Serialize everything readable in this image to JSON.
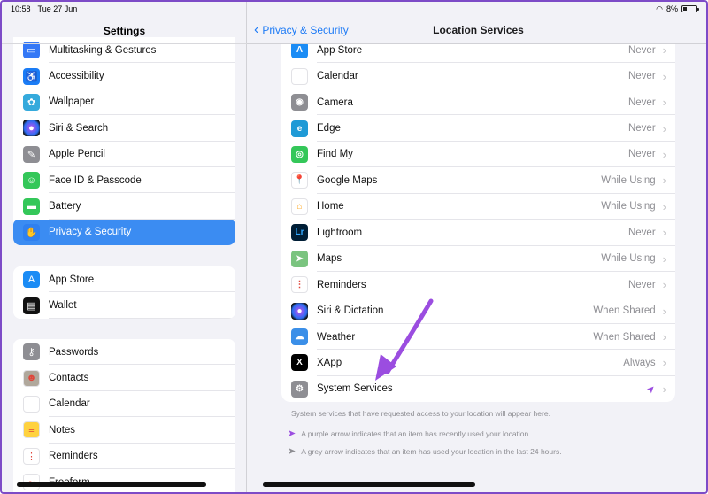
{
  "status": {
    "time": "10:58",
    "date": "Tue 27 Jun",
    "battery": "8%"
  },
  "sidebar": {
    "title": "Settings",
    "group1": [
      {
        "label": "Multitasking & Gestures",
        "icon": "multitasking-icon",
        "color": "#3478f6"
      },
      {
        "label": "Accessibility",
        "icon": "accessibility-icon",
        "color": "#1b7cf5"
      },
      {
        "label": "Wallpaper",
        "icon": "wallpaper-icon",
        "color": "#35aadc"
      },
      {
        "label": "Siri & Search",
        "icon": "siri-icon",
        "color": "#222222"
      },
      {
        "label": "Apple Pencil",
        "icon": "pencil-icon",
        "color": "#8e8e93"
      },
      {
        "label": "Face ID & Passcode",
        "icon": "faceid-icon",
        "color": "#34c759"
      },
      {
        "label": "Battery",
        "icon": "battery-icon",
        "color": "#34c759"
      },
      {
        "label": "Privacy & Security",
        "icon": "hand-icon",
        "color": "#2f80f0",
        "active": true
      }
    ],
    "group2": [
      {
        "label": "App Store",
        "icon": "appstore-icon",
        "color": "#1b8cf5"
      },
      {
        "label": "Wallet",
        "icon": "wallet-icon",
        "color": "#111111"
      }
    ],
    "group3": [
      {
        "label": "Passwords",
        "icon": "key-icon",
        "color": "#8e8e93"
      },
      {
        "label": "Contacts",
        "icon": "contacts-icon",
        "color": "#b0a89c"
      },
      {
        "label": "Calendar",
        "icon": "calendar-icon",
        "color": "#ffffff"
      },
      {
        "label": "Notes",
        "icon": "notes-icon",
        "color": "#ffd23f"
      },
      {
        "label": "Reminders",
        "icon": "reminders-icon",
        "color": "#ffffff"
      },
      {
        "label": "Freeform",
        "icon": "freeform-icon",
        "color": "#ffffff"
      }
    ]
  },
  "nav": {
    "back_label": "Privacy & Security",
    "title": "Location Services"
  },
  "apps": [
    {
      "label": "App Store",
      "value": "Never",
      "icon": "appstore-icon",
      "color": "#1b8cf5"
    },
    {
      "label": "Calendar",
      "value": "Never",
      "icon": "calendar-icon",
      "color": "#ffffff"
    },
    {
      "label": "Camera",
      "value": "Never",
      "icon": "camera-icon",
      "color": "#8e8e93"
    },
    {
      "label": "Edge",
      "value": "Never",
      "icon": "edge-icon",
      "color": "#1f9ad6"
    },
    {
      "label": "Find My",
      "value": "Never",
      "icon": "findmy-icon",
      "color": "#34c759"
    },
    {
      "label": "Google Maps",
      "value": "While Using",
      "icon": "google-maps-icon",
      "color": "#ffffff"
    },
    {
      "label": "Home",
      "value": "While Using",
      "icon": "home-icon",
      "color": "#ffffff"
    },
    {
      "label": "Lightroom",
      "value": "Never",
      "icon": "lightroom-icon",
      "color": "#001e36"
    },
    {
      "label": "Maps",
      "value": "While Using",
      "icon": "maps-icon",
      "color": "#7ac47f"
    },
    {
      "label": "Reminders",
      "value": "Never",
      "icon": "reminders-icon",
      "color": "#ffffff"
    },
    {
      "label": "Siri & Dictation",
      "value": "When Shared",
      "icon": "siri-icon",
      "color": "#222222"
    },
    {
      "label": "Weather",
      "value": "When Shared",
      "icon": "weather-icon",
      "color": "#3b8fe8"
    },
    {
      "label": "XApp",
      "value": "Always",
      "icon": "x-icon",
      "color": "#000000"
    },
    {
      "label": "System Services",
      "value": "",
      "icon": "gear-icon",
      "color": "#8e8e93",
      "indicator": "location-arrow-purple-icon"
    }
  ],
  "footnotes": {
    "info": "System services that have requested access to your location will appear here.",
    "purple": "A purple arrow indicates that an item has recently used your location.",
    "grey": "A grey arrow indicates that an item has used your location in the last 24 hours."
  },
  "colors": {
    "accent": "#1e7bf6",
    "purple": "#9b4de0",
    "grey_arrow": "#8e8e93"
  }
}
